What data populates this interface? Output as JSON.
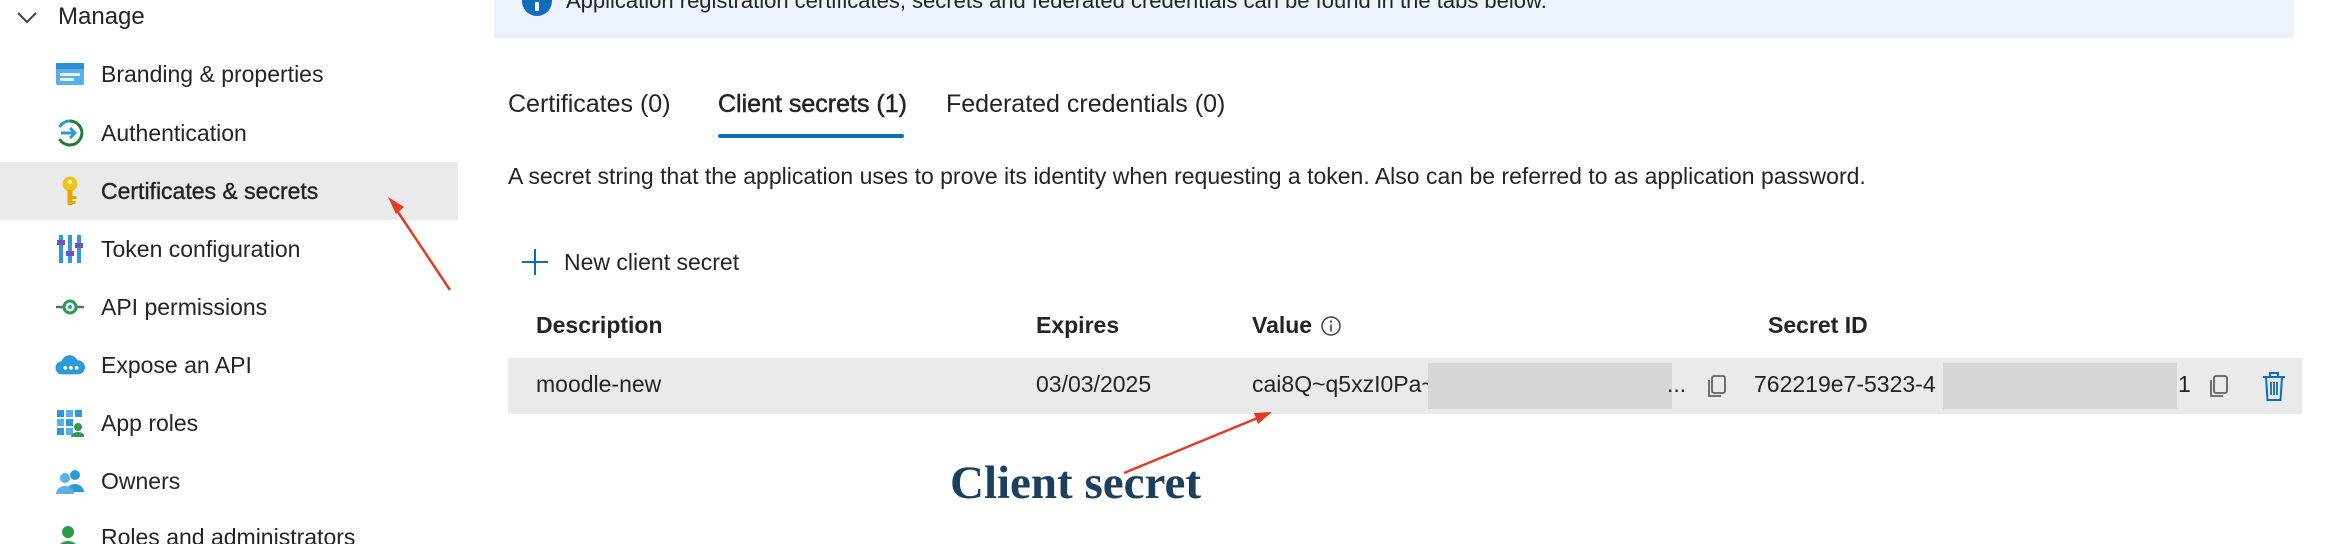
{
  "sidebar": {
    "section_title": "Manage",
    "items": [
      {
        "label": "Branding & properties"
      },
      {
        "label": "Authentication"
      },
      {
        "label": "Certificates & secrets"
      },
      {
        "label": "Token configuration"
      },
      {
        "label": "API permissions"
      },
      {
        "label": "Expose an API"
      },
      {
        "label": "App roles"
      },
      {
        "label": "Owners"
      },
      {
        "label": "Roles and administrators"
      }
    ]
  },
  "banner": {
    "text": "Application registration certificates, secrets and federated credentials can be found in the tabs below."
  },
  "tabs": [
    {
      "label": "Certificates (0)"
    },
    {
      "label": "Client secrets (1)"
    },
    {
      "label": "Federated credentials (0)"
    }
  ],
  "active_tab": "Client secrets (1)",
  "description": "A secret string that the application uses to prove its identity when requesting a token. Also can be referred to as application password.",
  "new_secret_label": "New client secret",
  "table": {
    "headers": {
      "description": "Description",
      "expires": "Expires",
      "value": "Value",
      "secret_id": "Secret ID"
    },
    "rows": [
      {
        "description": "moodle-new",
        "expires": "03/03/2025",
        "value_visible": "cai8Q~q5xzI0Pa~",
        "value_tail": "...",
        "secret_id_visible": "762219e7-5323-4",
        "secret_id_tail": "1"
      }
    ]
  },
  "annotation": {
    "label": "Client secret",
    "arrow_color": "#e03c28"
  },
  "colors": {
    "accent": "#0f6cbd",
    "active_row_bg": "#ebeaea",
    "banner_bg": "#ecf3fc",
    "annotation_text": "#1d3f5e"
  }
}
